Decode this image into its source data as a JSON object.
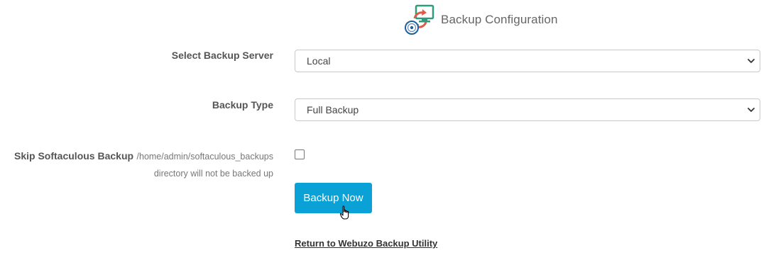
{
  "header": {
    "title": "Backup Configuration",
    "icon": "backup-config-icon"
  },
  "form": {
    "server_label": "Select Backup Server",
    "server_selected": "Local",
    "type_label": "Backup Type",
    "type_selected": "Full Backup",
    "skip_label": "Skip Softaculous Backup",
    "skip_help_path": "/home/admin/softaculous_backups",
    "skip_help_text": "directory will not be backed up",
    "skip_checked": false
  },
  "actions": {
    "backup_now_label": "Backup Now",
    "return_link_label": "Return to Webuzo Backup Utility"
  },
  "colors": {
    "button_bg": "#0aa2d6",
    "text": "#555555"
  }
}
